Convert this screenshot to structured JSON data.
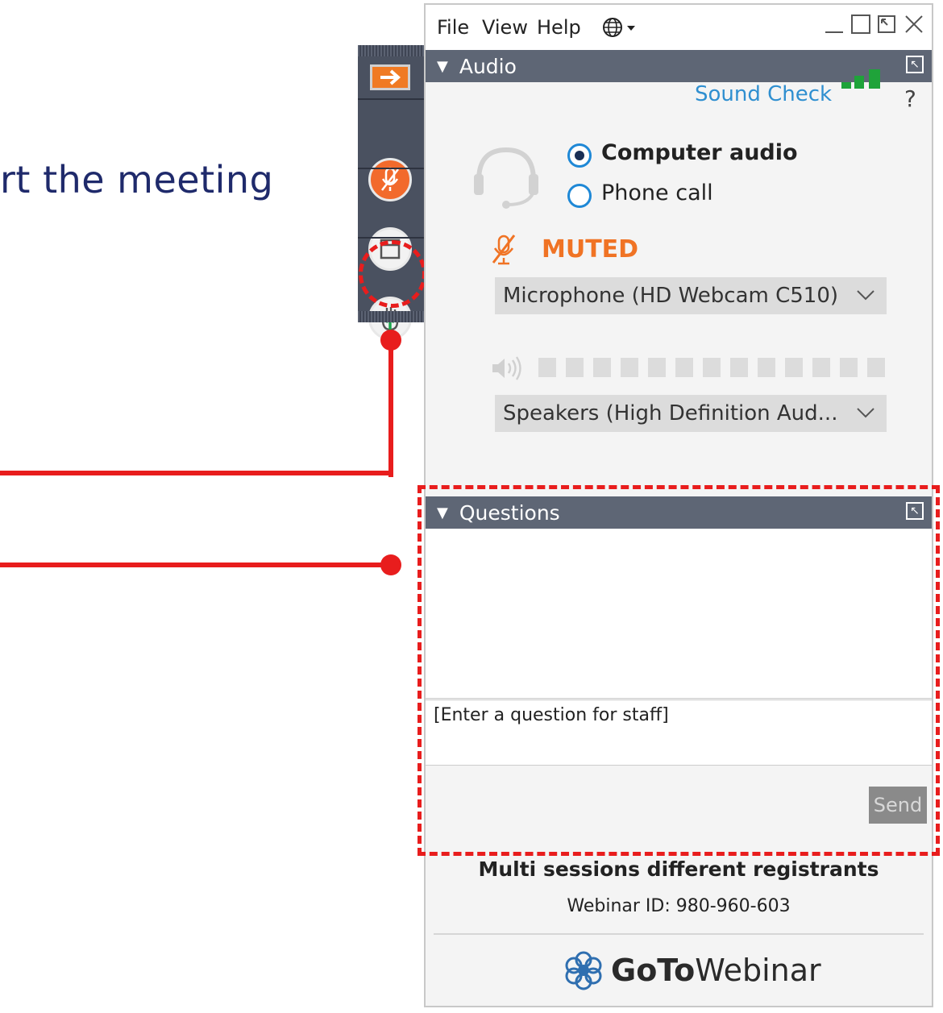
{
  "slide": {
    "text": "rt the meeting"
  },
  "menu": {
    "file": "File",
    "view": "View",
    "help": "Help"
  },
  "audio": {
    "title": "Audio",
    "sound_check": "Sound Check",
    "help_glyph": "?",
    "options": [
      {
        "label": "Computer audio",
        "selected": true
      },
      {
        "label": "Phone call",
        "selected": false
      }
    ],
    "status": "MUTED",
    "microphone": "Microphone (HD Webcam C510)",
    "speakers": "Speakers (High Definition Aud..."
  },
  "questions": {
    "title": "Questions",
    "placeholder": "[Enter a question for staff]",
    "send_label": "Send"
  },
  "footer": {
    "session_title": "Multi sessions different registrants",
    "webinar_id": "Webinar ID: 980-960-603",
    "brand_bold": "GoTo",
    "brand_light": "Webinar"
  },
  "colors": {
    "accent_orange": "#f07324",
    "callout_red": "#e81d1d",
    "header_gray": "#5e6675",
    "link_blue": "#2f8fd0",
    "signal_green": "#1fa33a"
  }
}
